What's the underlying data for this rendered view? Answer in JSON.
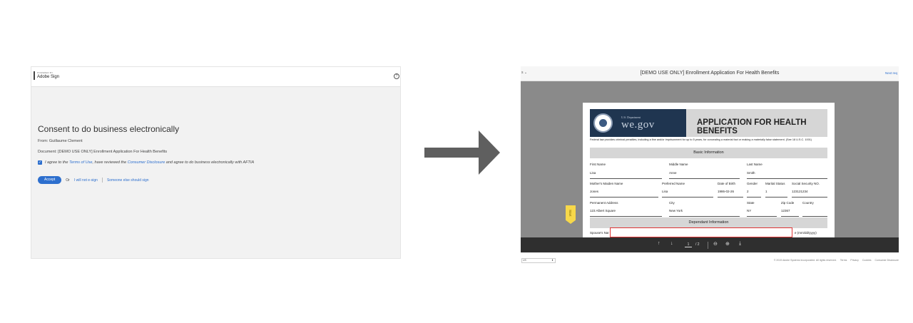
{
  "left": {
    "powered_by": "POWERED BY",
    "brand": "Adobe Sign",
    "help_icon": "?",
    "title": "Consent to do business electronically",
    "from": "From: Guillaume Clement",
    "document": "Document: [DEMO USE ONLY] Enrollment Application For Health Benefits",
    "agree_prefix": "I agree to the ",
    "terms_link": "Terms of Use",
    "agree_middle": ", have reviewed the ",
    "disclosure_link": "Consumer Disclosure",
    "agree_suffix": " and agree to do business electronically with AFTIA",
    "checkbox_mark": "✓",
    "accept_label": "Accept",
    "or_label": "Or",
    "not_signer_label": "I will not e-sign",
    "someone_else_label": "Someone else should sign"
  },
  "right": {
    "header_left": "s ⌄",
    "header_title": "[DEMO USE ONLY] Enrollment Application For Health Benefits",
    "header_next": "Next req",
    "start_tab": "Start",
    "doc": {
      "dept": "U.S. Department",
      "logo_text": "we.gov",
      "app_title": "APPLICATION FOR HEALTH BENEFITS",
      "penalty": "Federal law provides criminal penalties, including a fine and/or imprisonment for up to 5 years, for concealing a material fact or making a materially false statement. (See 18 U.S.C. 1001)",
      "section_basic": "Basic Information",
      "section_dependant": "Dependant Information",
      "labels": {
        "first_name": "First Name",
        "middle_name": "Middle Name",
        "last_name": "Last Name",
        "maiden_name": "Mother's Maiden Name",
        "preferred_name": "Preferred Name",
        "dob": "Date of Birth",
        "gender": "Gender",
        "marital": "Marital Status",
        "ssn": "Social Security NO.",
        "address": "Permanent Address",
        "city": "City",
        "state": "State",
        "zip": "Zip Code",
        "country": "Country",
        "spouse": "Spouse's Nar",
        "spouse_date": "e (mm/dd/yyyy)"
      },
      "values": {
        "first_name": "Lisa",
        "middle_name": "Anne",
        "last_name": "Smith",
        "maiden_name": "Jones",
        "preferred_name": "Lisa",
        "dob": "1986-02-26",
        "gender": "2",
        "marital": "1",
        "ssn": "123121234",
        "address": "123 Albert Square",
        "city": "New York",
        "state": "NY",
        "zip": "12367",
        "country": ""
      }
    },
    "toolbar": {
      "up_icon": "↑",
      "down_icon": "↓",
      "page_current": "1",
      "page_total": "/ 2",
      "zoom_out_icon": "⊖",
      "zoom_in_icon": "⊕",
      "download_icon": "⤓"
    },
    "footer": {
      "language": "US",
      "copyright": "© 2019 Adobe Systems Incorporated. All rights reserved.",
      "terms": "Terms",
      "privacy": "Privacy",
      "cookies": "Cookies",
      "consumer": "Consumer Disclosure"
    }
  },
  "colors": {
    "accent": "#2d6fce",
    "arrow": "#5f5f5f",
    "viewer_bg": "#8a8a8a",
    "toolbar_bg": "#2f2f2f",
    "start_tab": "#f7d84a",
    "logo_bg": "#1f3550"
  }
}
